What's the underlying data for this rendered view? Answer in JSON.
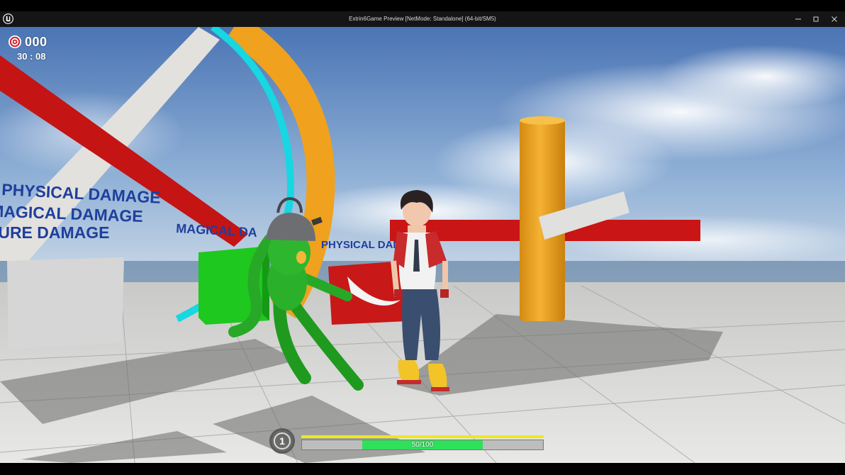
{
  "window": {
    "title": "Extrin6Game Preview [NetMode: Standalone]  (64-bit/SM5)",
    "minimize_icon": "minimize-icon",
    "maximize_icon": "maximize-icon",
    "close_icon": "close-icon",
    "logo_icon": "unreal-engine-logo"
  },
  "hud": {
    "score_icon": "target-icon",
    "score": "000",
    "timer": "30 : 08",
    "level": "1",
    "experience_fraction": 1.0,
    "health": {
      "label": "50/100",
      "current": 50,
      "max": 100
    }
  },
  "scene_text": {
    "sign_physical_left": "PHYSICAL DAMAGE",
    "sign_magical_left": "MAGICAL DAMAGE",
    "sign_pure_left": "PURE DAMAGE",
    "sign_magical_mid": "MAGICAL DA",
    "sign_physical_mid": "PHYSICAL DAM"
  },
  "colors": {
    "sky_top": "#4f79b8",
    "sky_bottom": "#c9d7e6",
    "floor": "#d9d9d9",
    "health_fill": "#2fe05a",
    "xp_fill": "#f0e81a",
    "text_blue": "#1f3f9c"
  }
}
